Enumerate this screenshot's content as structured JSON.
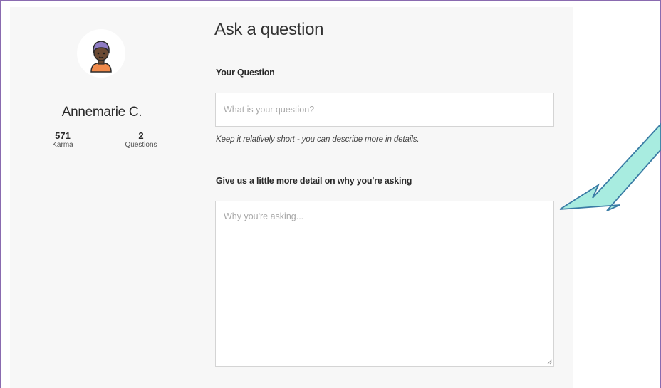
{
  "profile": {
    "name": "Annemarie C.",
    "karma_value": "571",
    "karma_label": "Karma",
    "questions_value": "2",
    "questions_label": "Questions",
    "avatar_icon": "person-avatar-icon"
  },
  "form": {
    "title": "Ask a question",
    "question_label": "Your Question",
    "question_placeholder": "What is your question?",
    "question_value": "",
    "question_hint": "Keep it relatively short - you can describe more in details.",
    "detail_label": "Give us a little more detail on why you're asking",
    "detail_placeholder": "Why you're asking...",
    "detail_value": ""
  },
  "annotation": {
    "arrow_icon": "arrow-pointer-icon",
    "arrow_color": "#a8ece0",
    "arrow_stroke": "#3a7ca5"
  },
  "colors": {
    "frame_border": "#8a6bb0",
    "panel_background": "#f7f7f7",
    "avatar_hair": "#8f7cc4",
    "avatar_shirt": "#f08a4b",
    "avatar_skin": "#6b4a33"
  }
}
